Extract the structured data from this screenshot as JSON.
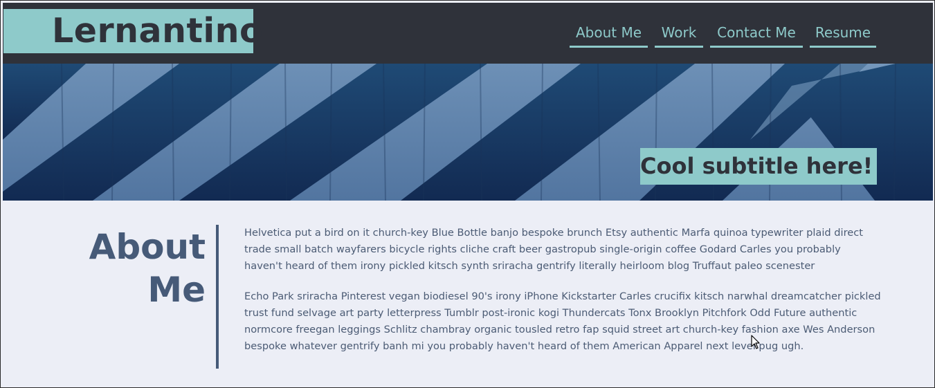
{
  "header": {
    "logo": "Lernantino",
    "nav": [
      {
        "label": "About Me"
      },
      {
        "label": "Work"
      },
      {
        "label": "Contact Me"
      },
      {
        "label": "Resume"
      }
    ]
  },
  "hero": {
    "subtitle": "Cool subtitle here!"
  },
  "about": {
    "heading_line1": "About",
    "heading_line2": "Me",
    "paragraphs": [
      "Helvetica put a bird on it church-key Blue Bottle banjo bespoke brunch Etsy authentic Marfa quinoa typewriter plaid direct trade small batch wayfarers bicycle rights cliche craft beer gastropub single-origin coffee Godard Carles you probably haven't heard of them irony pickled kitsch synth sriracha gentrify literally heirloom blog Truffaut paleo scenester",
      "Echo Park sriracha Pinterest vegan biodiesel 90's irony iPhone Kickstarter Carles crucifix kitsch narwhal dreamcatcher pickled trust fund selvage art party letterpress Tumblr post-ironic kogi Thundercats Tonx Brooklyn Pitchfork Odd Future authentic normcore freegan leggings Schlitz chambray organic tousled retro fap squid street art church-key fashion axe Wes Anderson bespoke whatever gentrify banh mi you probably haven't heard of them American Apparel next level pug ugh."
    ]
  },
  "colors": {
    "header_bg": "#2f323a",
    "accent": "#8ecaca",
    "page_bg": "#eceef6",
    "heading": "#465a78",
    "text": "#4b5b74"
  },
  "icons": {
    "cursor": "mouse-pointer-icon"
  }
}
